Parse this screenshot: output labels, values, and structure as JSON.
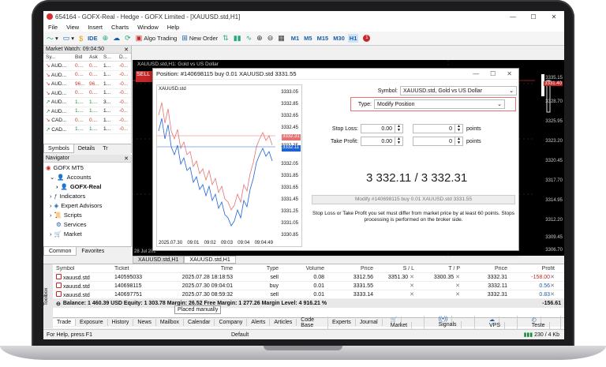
{
  "window": {
    "title": "654164 - GOFX-Real - Hedge - GOFX Limited - [XAUUSD.std,H1]"
  },
  "menu": [
    "File",
    "View",
    "Insert",
    "Charts",
    "Window",
    "Help"
  ],
  "toolbar": {
    "ide": "IDE",
    "algo": "Algo Trading",
    "new_order": "New Order",
    "timeframes": [
      "M1",
      "M5",
      "M15",
      "M30",
      "H1"
    ],
    "notif_count": "1"
  },
  "market_watch": {
    "title": "Market Watch: 09:04:50",
    "columns": [
      "Sy...",
      "Bid",
      "Ask",
      "S...",
      "D..."
    ],
    "rows": [
      {
        "sym": "AUD...",
        "bid": "0....",
        "ask": "0....",
        "s": "1...",
        "d": "-0...",
        "dir": "dn"
      },
      {
        "sym": "AUD...",
        "bid": "0....",
        "ask": "0....",
        "s": "1...",
        "d": "-0...",
        "dir": "dn"
      },
      {
        "sym": "AUD...",
        "bid": "96...",
        "ask": "96...",
        "s": "1...",
        "d": "-0...",
        "dir": "dn"
      },
      {
        "sym": "AUD...",
        "bid": "0....",
        "ask": "0....",
        "s": "1...",
        "d": "-0...",
        "dir": "dn"
      },
      {
        "sym": "AUD...",
        "bid": "1....",
        "ask": "1....",
        "s": "3...",
        "d": "-0...",
        "dir": "up"
      },
      {
        "sym": "AUD...",
        "bid": "1....",
        "ask": "1....",
        "s": "1...",
        "d": "-0...",
        "dir": "up"
      },
      {
        "sym": "CAD...",
        "bid": "0....",
        "ask": "0....",
        "s": "1...",
        "d": "-0...",
        "dir": "dn"
      },
      {
        "sym": "CAD...",
        "bid": "1....",
        "ask": "1....",
        "s": "1...",
        "d": "-0...",
        "dir": "up"
      }
    ],
    "tabs": [
      "Symbols",
      "Details",
      "Tr"
    ]
  },
  "navigator": {
    "title": "Navigator",
    "items": [
      "GOFX MT5",
      "Accounts",
      "GOFX-Real",
      "Indicators",
      "Expert Advisors",
      "Scripts",
      "Services",
      "Market"
    ],
    "tabs": [
      "Common",
      "Favorites"
    ]
  },
  "chart": {
    "title": "XAUUSD.std,H1: Gold vs US Dollar",
    "sell": "SELL",
    "axis": [
      "3335.15",
      "3331.40",
      "3328.70",
      "3325.95",
      "3323.20",
      "3320.45",
      "3317.70",
      "3314.95",
      "3312.20",
      "3309.45",
      "3306.70"
    ],
    "date": "28 Jul 202",
    "tabs": [
      "XAUUSD.std,H1",
      "XAUUSD.std,H1"
    ]
  },
  "dialog": {
    "title": "Position: #140698115 buy 0.01 XAUUSD.std 3331.55",
    "mini_symbol": "XAUUSD.std",
    "mini_axis": [
      "3333.05",
      "3332.85",
      "3332.65",
      "3332.45",
      "3332.25",
      "3332.05",
      "3331.85",
      "3331.65",
      "3331.45",
      "3331.25",
      "3331.05",
      "3330.85",
      "3330.65"
    ],
    "mini_bid": "3332.11",
    "mini_ask": "3332.31",
    "mini_times": [
      "2025.07.30",
      "09:01",
      "09:02",
      "09:03",
      "09:04",
      "09:04:49"
    ],
    "symbol_label": "Symbol:",
    "symbol_value": "XAUUSD.std, Gold vs US Dollar",
    "type_label": "Type:",
    "type_value": "Modify Position",
    "stoploss_label": "Stop Loss:",
    "takeprofit_label": "Take Profit:",
    "sl_value": "0.00",
    "tp_value": "0.00",
    "sl_points": "0",
    "tp_points": "0",
    "points_label": "points",
    "price_text": "3 332.11 / 3 332.31",
    "modify_button": "Modify #140698115 buy 0.01 XAUUSD.std 3331.55",
    "note": "Stop Loss or Take Profit you set must differ from market price by at least 60 points. Stops processing is performed on the broker side."
  },
  "trade": {
    "headers": [
      "Symbol",
      "Ticket",
      "Time",
      "Type",
      "Volume",
      "Price",
      "S / L",
      "T / P",
      "Price",
      "Profit"
    ],
    "rows": [
      {
        "symbol": "xauusd.std",
        "ticket": "140595033",
        "time": "2025.07.28 18:18:53",
        "type": "sell",
        "volume": "0.08",
        "price": "3312.56",
        "sl": "3351.30",
        "tp": "3300.35",
        "cur": "3332.31",
        "profit": "-158.00"
      },
      {
        "symbol": "xauusd.std",
        "ticket": "140698115",
        "time": "2025.07.30 09:04:01",
        "type": "buy",
        "volume": "0.01",
        "price": "3331.55",
        "sl": "",
        "tp": "",
        "cur": "3332.11",
        "profit": "0.56"
      },
      {
        "symbol": "xauusd.std",
        "ticket": "140697751",
        "time": "2025.07.30 08:59:32",
        "type": "sell",
        "volume": "0.01",
        "price": "3333.14",
        "sl": "",
        "tp": "",
        "cur": "3332.31",
        "profit": "0.83"
      }
    ],
    "balance": "Balance: 1 460.39 USD  Equity: 1 303.78  Margin: 26.52  Free Margin: 1 277.26  Margin Level: 4 916.21 %",
    "total_profit": "-156.61",
    "tooltip": "Placed manually",
    "toolbox_label": "Toolbox",
    "tabs": [
      "Trade",
      "Exposure",
      "History",
      "News",
      "Mailbox",
      "Calendar",
      "Company",
      "Alerts",
      "Articles",
      "Code Base",
      "Experts",
      "Journal"
    ],
    "right_tabs": [
      "Market",
      "Signals",
      "VPS",
      "Teste"
    ]
  },
  "status": {
    "help": "For Help, press F1",
    "profile": "Default",
    "conn": "230 / 4 Kb"
  }
}
